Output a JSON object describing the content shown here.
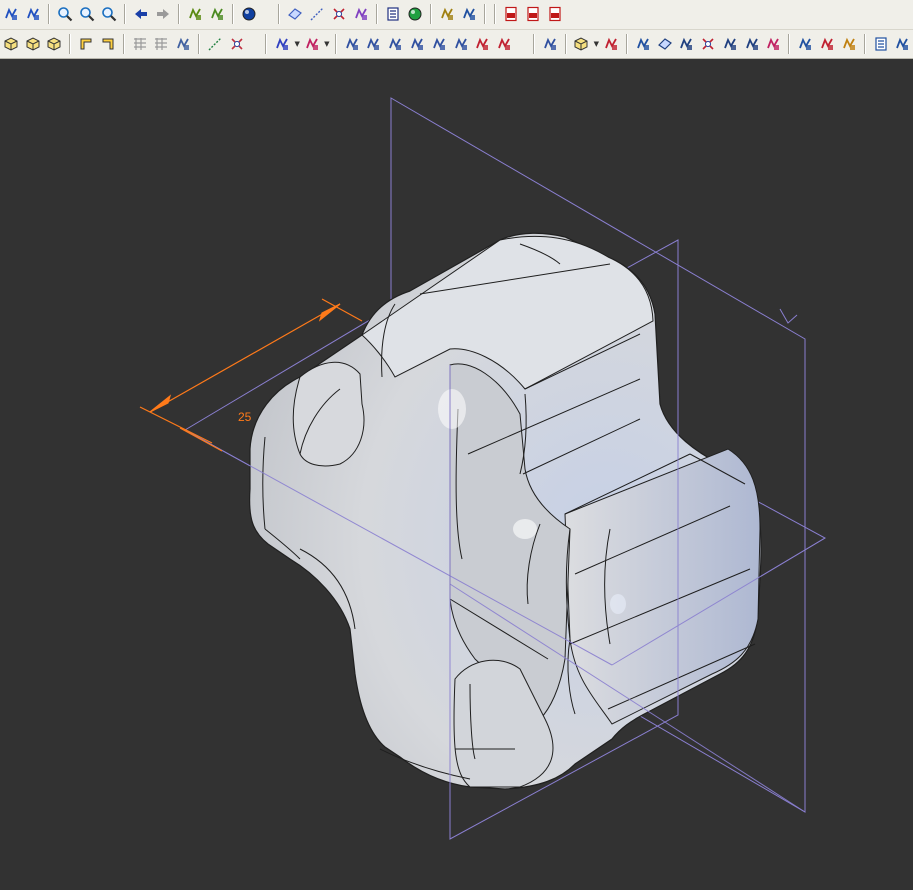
{
  "toolbar": {
    "row1": [
      {
        "name": "pan-view-icon",
        "color": "#2050c0"
      },
      {
        "name": "rotate-view-icon",
        "color": "#2050c0"
      },
      {
        "sep": true
      },
      {
        "name": "zoom-in-icon",
        "color": "#1a6fc0"
      },
      {
        "name": "zoom-window-icon",
        "color": "#1a6fc0"
      },
      {
        "name": "zoom-fit-icon",
        "color": "#1a6fc0"
      },
      {
        "sep": true
      },
      {
        "name": "previous-view-arrow-icon",
        "color": "#1a40a8"
      },
      {
        "name": "next-view-arrow-icon",
        "color": "#9a9a9a"
      },
      {
        "sep": true
      },
      {
        "name": "shaded-render-icon",
        "color": "#5a8a10"
      },
      {
        "name": "flag-icon",
        "color": "#4a8a20"
      },
      {
        "sep": true
      },
      {
        "name": "globe-render-icon",
        "color": "#1040a0"
      },
      {
        "gap": true
      },
      {
        "sep": true
      },
      {
        "name": "plane-icon",
        "color": "#4060c0"
      },
      {
        "name": "axis-line-icon",
        "color": "#4060c0"
      },
      {
        "name": "point-icon",
        "color": "#c02030"
      },
      {
        "name": "csys-icon",
        "color": "#8040c0"
      },
      {
        "sep": true
      },
      {
        "name": "layer-list-icon",
        "color": "#203080"
      },
      {
        "name": "appearance-sphere-icon",
        "color": "#20a040"
      },
      {
        "sep": true
      },
      {
        "name": "measure-icon",
        "color": "#a08010"
      },
      {
        "name": "balance-icon",
        "color": "#2050a0"
      },
      {
        "sep": true
      },
      {
        "sep": true
      },
      {
        "name": "pdf-export-icon",
        "color": "#c01818"
      },
      {
        "name": "pdf-export-next-icon",
        "color": "#c01818"
      },
      {
        "name": "pdf-print-icon",
        "color": "#c01818"
      }
    ],
    "row2": [
      {
        "name": "box-front-icon",
        "color": "#c8a010"
      },
      {
        "name": "box-iso-icon",
        "color": "#c8a010"
      },
      {
        "name": "box-top-icon",
        "color": "#c8a010"
      },
      {
        "sep": true
      },
      {
        "name": "corner-left-icon",
        "color": "#d09010"
      },
      {
        "name": "corner-right-icon",
        "color": "#d09010"
      },
      {
        "sep": true
      },
      {
        "name": "grid-disabled-icon",
        "color": "#9a9a9a"
      },
      {
        "name": "hatch-disabled-icon",
        "color": "#9a9a9a"
      },
      {
        "name": "edit-sketch-icon",
        "color": "#4060a0"
      },
      {
        "sep": true
      },
      {
        "name": "sketch-pencil-icon",
        "color": "#208040"
      },
      {
        "name": "datum-target-icon",
        "color": "#c03040"
      },
      {
        "gap": true
      },
      {
        "sep": true
      },
      {
        "name": "extrude-solid-icon",
        "color": "#3040c0",
        "drop": true
      },
      {
        "name": "revolve-feature-icon",
        "color": "#c02060",
        "drop": true
      },
      {
        "sep": true
      },
      {
        "name": "hole-feature-icon",
        "color": "#3050a0"
      },
      {
        "name": "shell-feature-icon",
        "color": "#3050a0"
      },
      {
        "name": "round-feature-icon",
        "color": "#3050a0"
      },
      {
        "name": "chamfer-feature-icon",
        "color": "#3050a0"
      },
      {
        "name": "draft-feature-icon",
        "color": "#3050a0"
      },
      {
        "name": "rib-feature-icon",
        "color": "#3050a0"
      },
      {
        "name": "pattern-feature-icon",
        "color": "#c02030"
      },
      {
        "name": "mirror-feature-icon",
        "color": "#c02030"
      },
      {
        "gap": true
      },
      {
        "sep": true
      },
      {
        "name": "analysis-shapes-icon",
        "color": "#3050a0"
      },
      {
        "sep": true
      },
      {
        "name": "display-style-cube-icon",
        "color": "#505050",
        "drop": true
      },
      {
        "name": "simplified-rep-icon",
        "color": "#c02030"
      },
      {
        "sep": true
      },
      {
        "name": "spin-center-icon",
        "color": "#2050a0"
      },
      {
        "name": "datum-planes-toggle-icon",
        "color": "#204080"
      },
      {
        "name": "datum-axes-toggle-icon",
        "color": "#204080"
      },
      {
        "name": "datum-points-toggle-icon",
        "color": "#c02030"
      },
      {
        "name": "csys-toggle-icon",
        "color": "#204080"
      },
      {
        "name": "annotation-toggle-icon",
        "color": "#204080"
      },
      {
        "name": "saved-views-icon",
        "color": "#c02060"
      },
      {
        "sep": true
      },
      {
        "name": "sketch-tools-icon",
        "color": "#2050a0"
      },
      {
        "name": "relations-icon",
        "color": "#c02030"
      },
      {
        "name": "parameters-icon",
        "color": "#c08010"
      },
      {
        "sep": true
      },
      {
        "name": "model-tree-icon",
        "color": "#2050a0"
      },
      {
        "name": "reorder-icon",
        "color": "#2050a0"
      }
    ]
  },
  "viewport": {
    "background": "#323232",
    "dimension_value": "25",
    "dimension_color": "#ff7a1a",
    "datum_plane_color": "#8a7fd0",
    "model_edge_color": "#1e1e1e",
    "model_surface_color": "#d4d8e0"
  }
}
